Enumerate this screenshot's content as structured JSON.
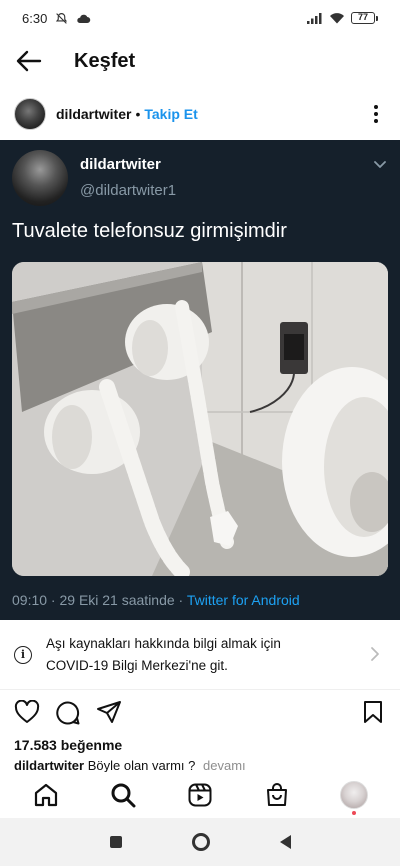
{
  "status_bar": {
    "time": "6:30",
    "battery": "77",
    "icons": [
      "mute-icon",
      "cloud-icon",
      "signal-icon",
      "wifi-icon",
      "battery-icon"
    ]
  },
  "header": {
    "title": "Keşfet",
    "back_icon": "arrow-left-icon"
  },
  "post": {
    "username": "dildartwiter",
    "separator": "•",
    "follow_label": "Takip Et",
    "more_icon": "three-dots-vertical-icon"
  },
  "tweet": {
    "name": "dildartwiter",
    "handle": "@dildartwiter1",
    "text": "Tuvalete telefonsuz girmişimdir",
    "timestamp": "09:10 · 29 Eki 21 saatinde · ",
    "source": "Twitter for Android",
    "chevron_icon": "chevron-down-icon"
  },
  "covid_banner": {
    "line1": "Aşı kaynakları hakkında bilgi almak için",
    "line2": "COVID-19 Bilgi Merkezi'ne git.",
    "info_symbol": "i"
  },
  "actions": {
    "icons": [
      "heart-icon",
      "comment-icon",
      "share-icon",
      "bookmark-icon"
    ]
  },
  "likes": "17.583 beğenme",
  "caption": {
    "username": "dildartwiter",
    "text": "Böyle olan varmı ?",
    "more": "devamı"
  },
  "bottom_nav": {
    "items": [
      "home-icon",
      "search-icon",
      "reels-icon",
      "shop-icon",
      "profile-avatar"
    ]
  },
  "colors": {
    "tweet_bg": "#15202b",
    "follow_blue": "#1a93ec",
    "twitter_blue": "#1da1f2",
    "muted": "#8899a6"
  }
}
